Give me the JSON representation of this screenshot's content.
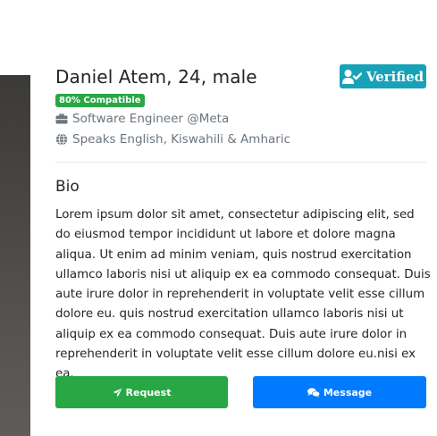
{
  "profile": {
    "name": "Daniel Atem, 24, male",
    "verified_label": "Verified",
    "compatibility": "80% Compatible",
    "occupation": "Software Engineer @Meta",
    "languages": "Speaks English, Kiswahili & Amharic"
  },
  "bio": {
    "title": "Bio",
    "text": "Lorem ipsum dolor sit amet, consectetur adipiscing elit, sed do eiusmod tempor incididunt ut labore et dolore magna aliqua. Ut enim ad minim veniam, quis nostrud exercitation ullamco laboris nisi ut aliquip ex ea commodo consequat. Duis aute irure dolor in reprehenderit in voluptate velit esse cillum dolore eu. quis nostrud exercitation ullamco laboris nisi ut aliquip ex ea commodo consequat. Duis aute irure dolor in reprehenderit in voluptate velit esse cillum dolore eu.nisi ex ea."
  },
  "actions": {
    "request_label": "Request",
    "message_label": "Message"
  },
  "icons": {
    "verified": "user-check-icon",
    "occupation": "briefcase-icon",
    "languages": "globe-icon",
    "request": "paper-plane-icon",
    "message": "chat-bubbles-icon"
  },
  "colors": {
    "verified_badge": "#17a2b8",
    "compat_badge": "#28a745",
    "request_button": "#28a745",
    "message_button": "#007bff",
    "muted_text": "#6c757d"
  }
}
